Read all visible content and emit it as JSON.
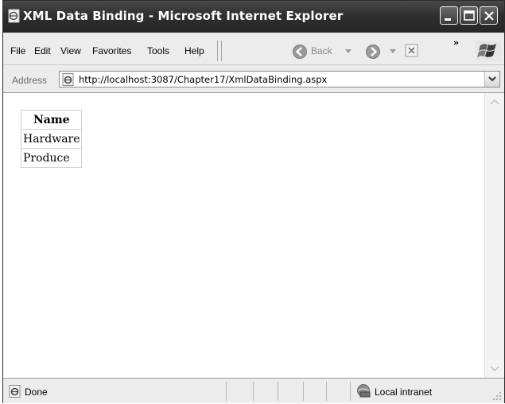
{
  "window": {
    "title": "XML Data Binding - Microsoft Internet Explorer"
  },
  "menu": {
    "items": [
      {
        "label": "File"
      },
      {
        "label": "Edit"
      },
      {
        "label": "View"
      },
      {
        "label": "Favorites"
      },
      {
        "label": "Tools"
      },
      {
        "label": "Help"
      }
    ],
    "back_label": "Back",
    "more_glyph": "»"
  },
  "address": {
    "label": "Address",
    "url": "http://localhost:3087/Chapter17/XmlDataBinding.aspx"
  },
  "grid": {
    "header": "Name",
    "rows": [
      "Hardware",
      "Produce"
    ]
  },
  "status": {
    "text": "Done",
    "zone": "Local intranet"
  }
}
